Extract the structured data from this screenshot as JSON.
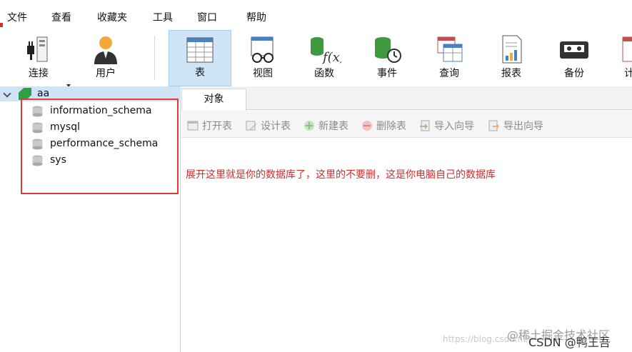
{
  "menu": {
    "file": "文件",
    "view": "查看",
    "favorites": "收藏夹",
    "tools": "工具",
    "window": "窗口",
    "help": "帮助"
  },
  "toolbar": {
    "connection": "连接",
    "user": "用户",
    "table": "表",
    "view": "视图",
    "function": "函数",
    "event": "事件",
    "query": "查询",
    "report": "报表",
    "backup": "备份",
    "more": "计"
  },
  "navigator": {
    "connection": "aa",
    "databases": [
      "information_schema",
      "mysql",
      "performance_schema",
      "sys"
    ]
  },
  "tabs": {
    "objects": "对象"
  },
  "objectbar": {
    "open": "打开表",
    "design": "设计表",
    "new": "新建表",
    "delete": "删除表",
    "import": "导入向导",
    "export": "导出向导"
  },
  "annotation": "展开这里就是你的数据库了，这里的不要删，这是你电脑自己的数据库",
  "watermark": {
    "juejin": "@稀土掘金技术社区",
    "csdn": "CSDN @鸭王吾",
    "url": "https://blog.csdn.net"
  },
  "colors": {
    "accent": "#cfe4f7",
    "annotation": "#d52b2b",
    "leaf": "#2ea043"
  }
}
